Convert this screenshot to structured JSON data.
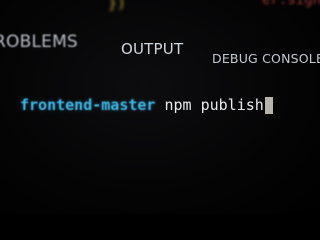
{
  "editor": {
    "top_fragment_text": "})",
    "top_right_fragment_text": "er.sign"
  },
  "panel": {
    "tabs": [
      {
        "label": "ROBLEMS"
      },
      {
        "label": "OUTPUT"
      },
      {
        "label": "DEBUG CONSOLE"
      }
    ]
  },
  "terminal": {
    "prompt": "frontend-master",
    "command": "npm publish"
  },
  "colors": {
    "background": "#000000",
    "prompt": "#3fb8e8",
    "command": "#e9ebee",
    "tab_text": "#c9ced6",
    "cursor": "#b8b2ac"
  }
}
